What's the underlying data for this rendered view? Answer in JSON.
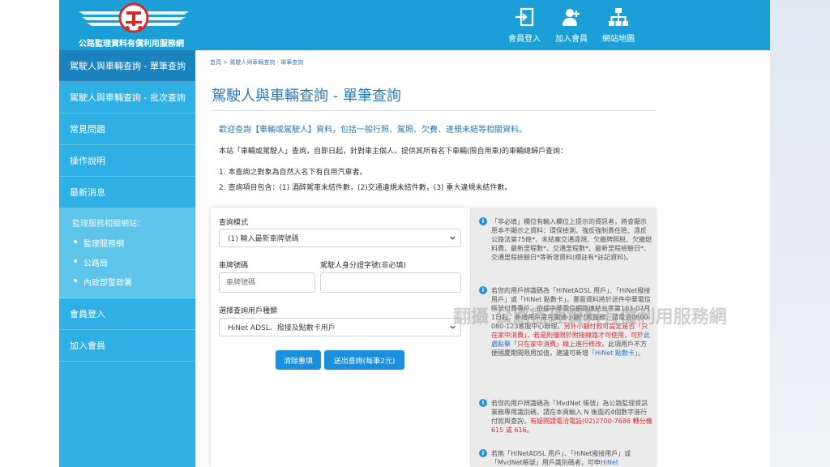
{
  "header": {
    "site_name": "公路監理資料有償利用服務網",
    "nav": [
      {
        "label": "會員登入",
        "icon": "login-icon"
      },
      {
        "label": "加入會員",
        "icon": "add-user-icon"
      },
      {
        "label": "網站地圖",
        "icon": "sitemap-icon"
      }
    ]
  },
  "sidebar": {
    "items": [
      {
        "label": "駕駛人與車輛查詢 - 單筆查詢"
      },
      {
        "label": "駕駛人與車輛查詢 - 批次查詢"
      },
      {
        "label": "常見問題"
      },
      {
        "label": "操作說明"
      },
      {
        "label": "最新消息"
      }
    ],
    "related_title": "監理服務相關網站：",
    "related_links": [
      "監理服務網",
      "公路局",
      "內政部警政署"
    ],
    "bottom_items": [
      {
        "label": "會員登入"
      },
      {
        "label": "加入會員"
      }
    ]
  },
  "breadcrumb": "首頁 > 駕駛人與車輛查詢 - 單筆查詢",
  "page_title": "駕駛人與車輛查詢 - 單筆查詢",
  "intro": {
    "welcome": "歡迎查詢【車輛或駕駛人】資料，包括一般行照、駕照、欠費、違規未結等相關資料。",
    "line1": "本站「車輛或駕駛人」查詢，自即日起，針對車主個人，提供其所有名下車輛(限自用車)的車輛總歸戶查詢：",
    "line2": "1. 本查詢之對象為自然人名下有自用汽車者。",
    "line3": "2. 查詢項目包含：(1) 酒醉駕車未結件數，(2)交通違規未結件數，(3) 重大違規未結件數。"
  },
  "form": {
    "mode_label": "查詢模式",
    "mode_value": "(1) 輸入最新車牌號碼",
    "plate_label": "車牌號碼",
    "plate_placeholder": "車牌號碼",
    "plate_value": "",
    "id_label": "駕駛人身分證字號(非必填)",
    "id_placeholder": "",
    "id_value": "",
    "user_type_label": "選擇查詢用戶種類",
    "user_type_value": "HiNet ADSL、撥接及點數卡用戶",
    "clear_button": "清除重填",
    "submit_button": "送出查詢(每筆2元)"
  },
  "info": [
    {
      "text": "「非必填」欄位有輸入欄位上提示的資訊者，將會顯示原本不顯示之資料：環保檢測、強反強制責任險、違反公路法第75條*、未結案交通違規、欠繳牌照稅、欠繳燃料費、最新里程數*、交通里程數*、最新里程檢驗日*、交通里程檢驗日*等新增資料(標註有*註記資料)。"
    },
    {
      "text_a": "若您的用戶辨識碼為「HiNetADSL 用戶」、「HiNet撥接 用戶」或「HiNet 點數卡」，書面資料將於送件中華電信帳號付費專戶。依據中華電信網路連結台字第103-07月1日起，新增用戶需先開通小額付款服務，請電洽0800-080-123客服中心辦理。",
      "text_red": "另外小額付款可設定是否「只在家中消費」，若是則僅限於附接線路才可使用，可於",
      "text_blue": "此處點擊",
      "text_red2": "「只在家中消費」線上進行修改，",
      "text_b": "此項用戶不方便國慶期間限用加值，建議可新增",
      "text_blue2": "「HiNet 點數卡」",
      "text_c": "。"
    },
    {
      "text_a": "若您的用戶辨識碼為「MvdNet 帳號」為公路監理資訊業務專用識別碼，請在本頁輸入 N 後面的4個數字進行付款與查詢，",
      "text_red": "有疑問請電洽電話(02)2700-7686 轉分機615 或 616。"
    },
    {
      "text_a": "若無「HiNetADSL 用戶」、「HiNet撥接用戶」或「MvdNet帳號」用戶識別碼者，可申",
      "text_blue": "HiNet"
    }
  ],
  "watermark": "翻攝 公路監理資料有償利用服務網",
  "colors": {
    "header": "#1c9ed6",
    "sidebar": "#2eb0e4",
    "sidebar_active": "#1a83be",
    "button": "#1a8fde",
    "title": "#2a77b8"
  }
}
